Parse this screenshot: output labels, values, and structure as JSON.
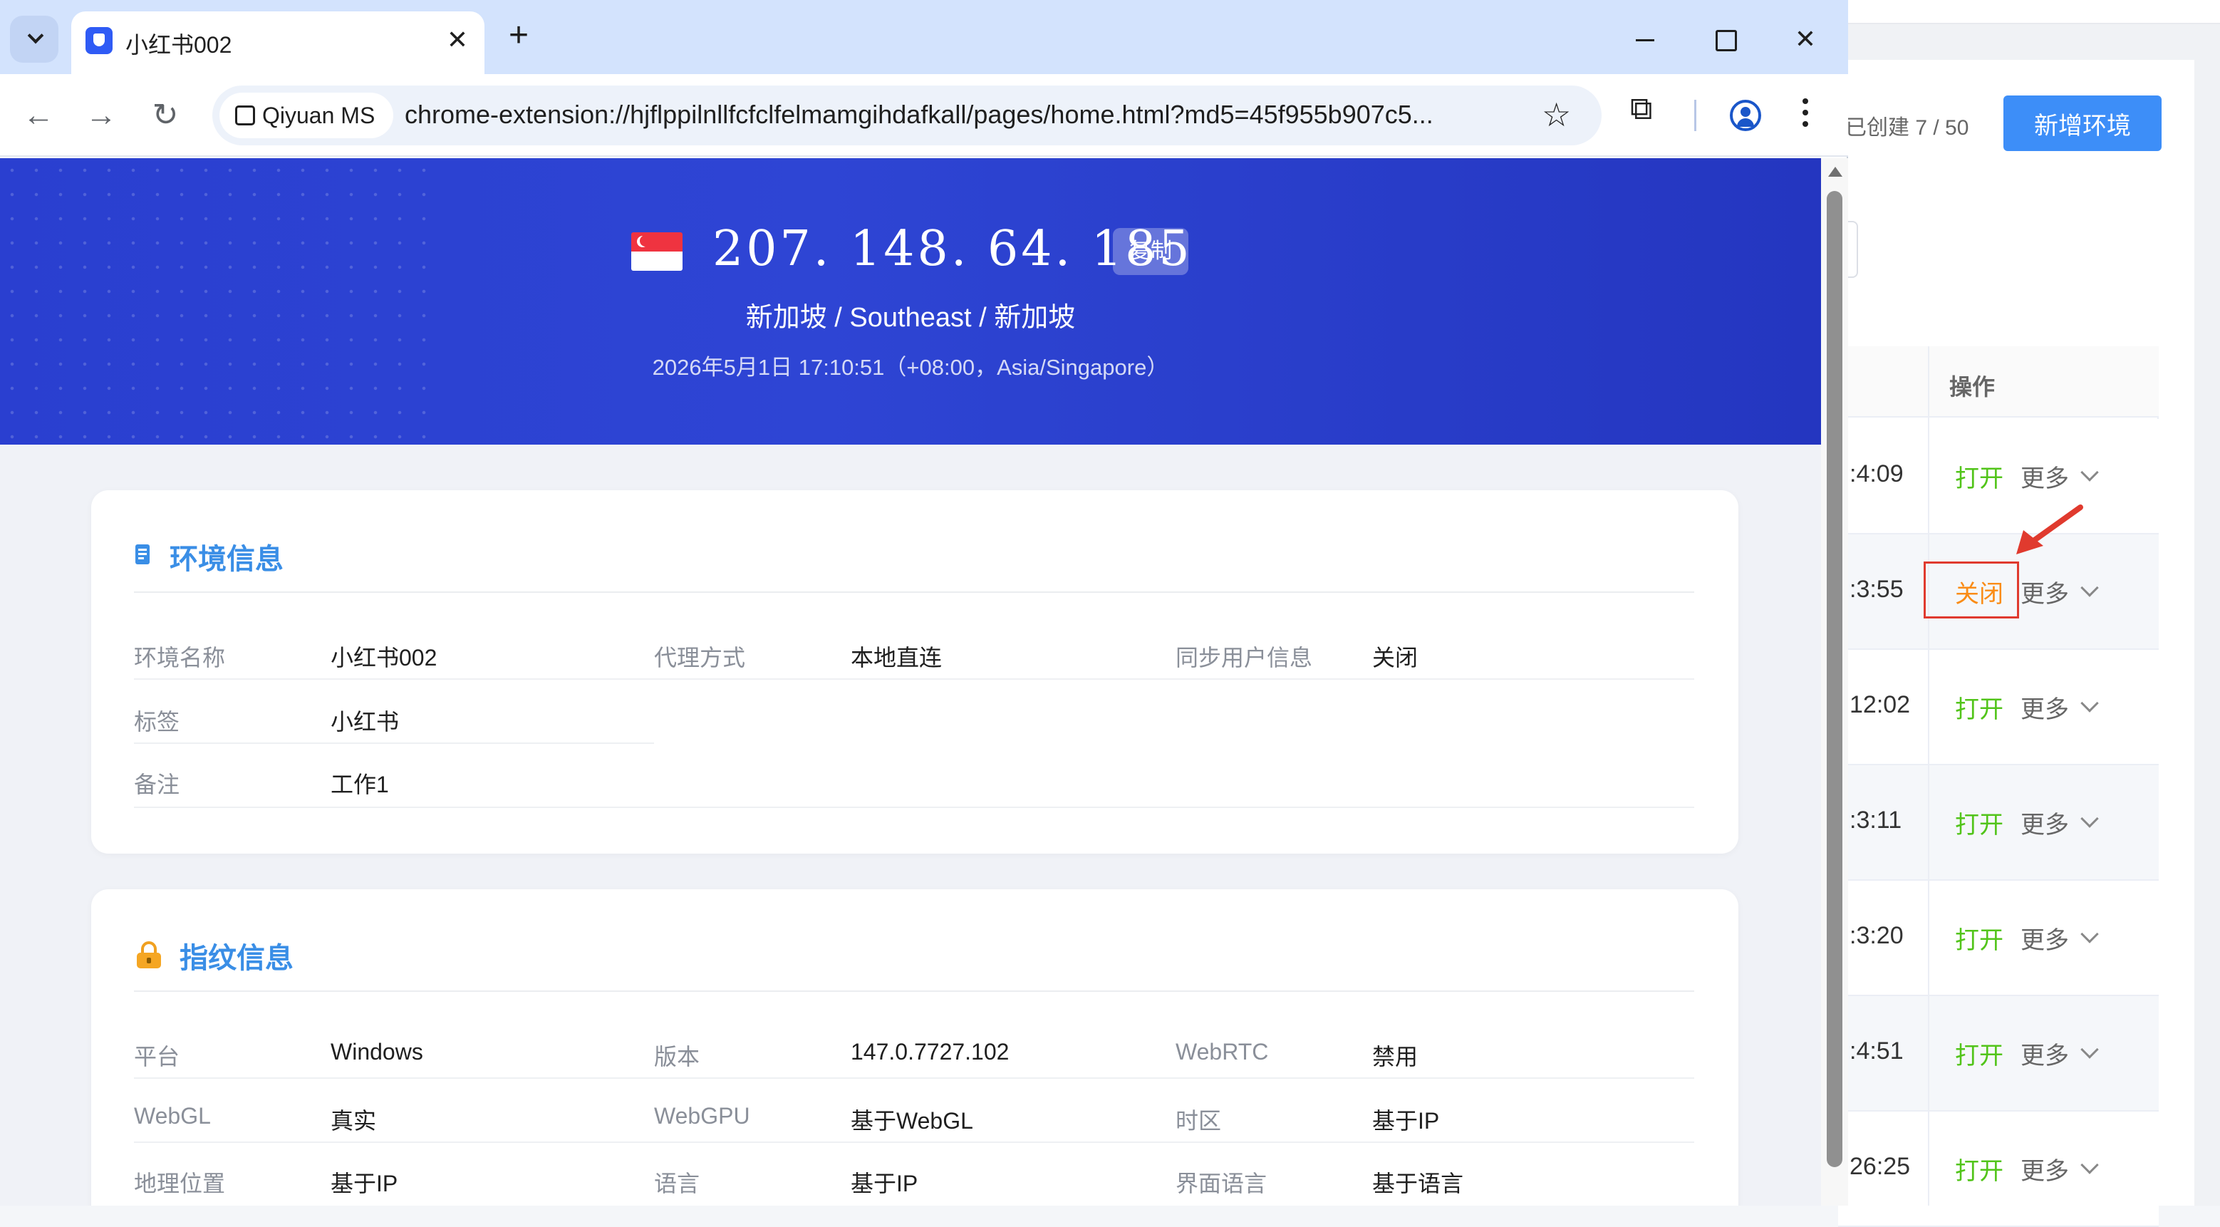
{
  "background_app": {
    "created_count": "已创建 7 / 50",
    "add_button": "新增环境",
    "ops_header": "操作",
    "rows": [
      {
        "time": ":4:09",
        "action": "打开",
        "more": "更多"
      },
      {
        "time": ":3:55",
        "action": "关闭",
        "more": "更多"
      },
      {
        "time": "12:02",
        "action": "打开",
        "more": "更多"
      },
      {
        "time": ":3:11",
        "action": "打开",
        "more": "更多"
      },
      {
        "time": ":3:20",
        "action": "打开",
        "more": "更多"
      },
      {
        "time": ":4:51",
        "action": "打开",
        "more": "更多"
      },
      {
        "time": "26:25",
        "action": "打开",
        "more": "更多"
      }
    ]
  },
  "browser": {
    "tab_title": "小红书002",
    "site_chip": "Qiyuan MS",
    "url": "chrome-extension://hjflppilnllfcfclfelmamgihdafkall/pages/home.html?md5=45f955b907c5..."
  },
  "hero": {
    "ip": "207. 148. 64. 185",
    "copy_label": "复制",
    "location": "新加坡 / Southeast / 新加坡",
    "datetime": "2026年5月1日 17:10:51（+08:00，Asia/Singapore）"
  },
  "env_info": {
    "title": "环境信息",
    "fields": {
      "name_label": "环境名称",
      "name_value": "小红书002",
      "proxy_label": "代理方式",
      "proxy_value": "本地直连",
      "sync_label": "同步用户信息",
      "sync_value": "关闭",
      "tag_label": "标签",
      "tag_value": "小红书",
      "note_label": "备注",
      "note_value": "工作1"
    }
  },
  "fp_info": {
    "title": "指纹信息",
    "fields": {
      "platform_label": "平台",
      "platform_value": "Windows",
      "version_label": "版本",
      "version_value": "147.0.7727.102",
      "webrtc_label": "WebRTC",
      "webrtc_value": "禁用",
      "webgl_label": "WebGL",
      "webgl_value": "真实",
      "webgpu_label": "WebGPU",
      "webgpu_value": "基于WebGL",
      "tz_label": "时区",
      "tz_value": "基于IP",
      "geo_label": "地理位置",
      "geo_value": "基于IP",
      "lang_label": "语言",
      "lang_value": "基于IP",
      "uilang_label": "界面语言",
      "uilang_value": "基于语言"
    }
  }
}
